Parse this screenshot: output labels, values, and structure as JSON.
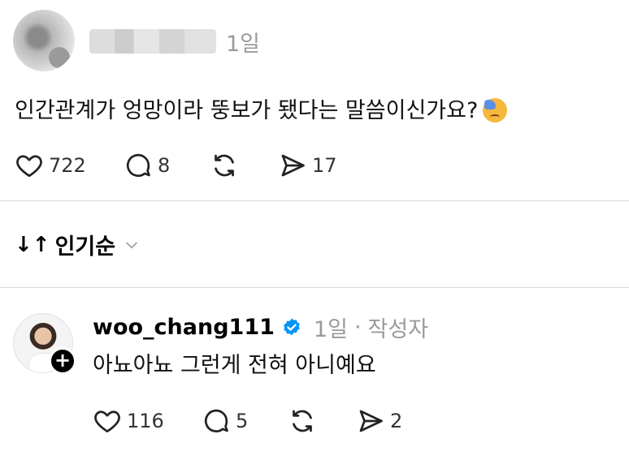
{
  "post": {
    "time": "1일",
    "text": "인간관계가 엉망이라 뚱보가 됐다는 말씀이신가요?",
    "emoji_icon": "downcast-sweat-face-emoji",
    "likes": "722",
    "comments": "8",
    "shares": "17"
  },
  "sort": {
    "arrows": "↓↑",
    "label": "인기순"
  },
  "reply": {
    "username": "woo_chang111",
    "time": "1일",
    "separator": "·",
    "author_tag": "작성자",
    "text": "아뇨아뇨 그런게 전혀 아니예요",
    "likes": "116",
    "comments": "5",
    "shares": "2",
    "follow_symbol": "+"
  },
  "colors": {
    "verified": "#0095f6",
    "muted": "#9a9a9a",
    "divider": "#d9d9d9"
  }
}
